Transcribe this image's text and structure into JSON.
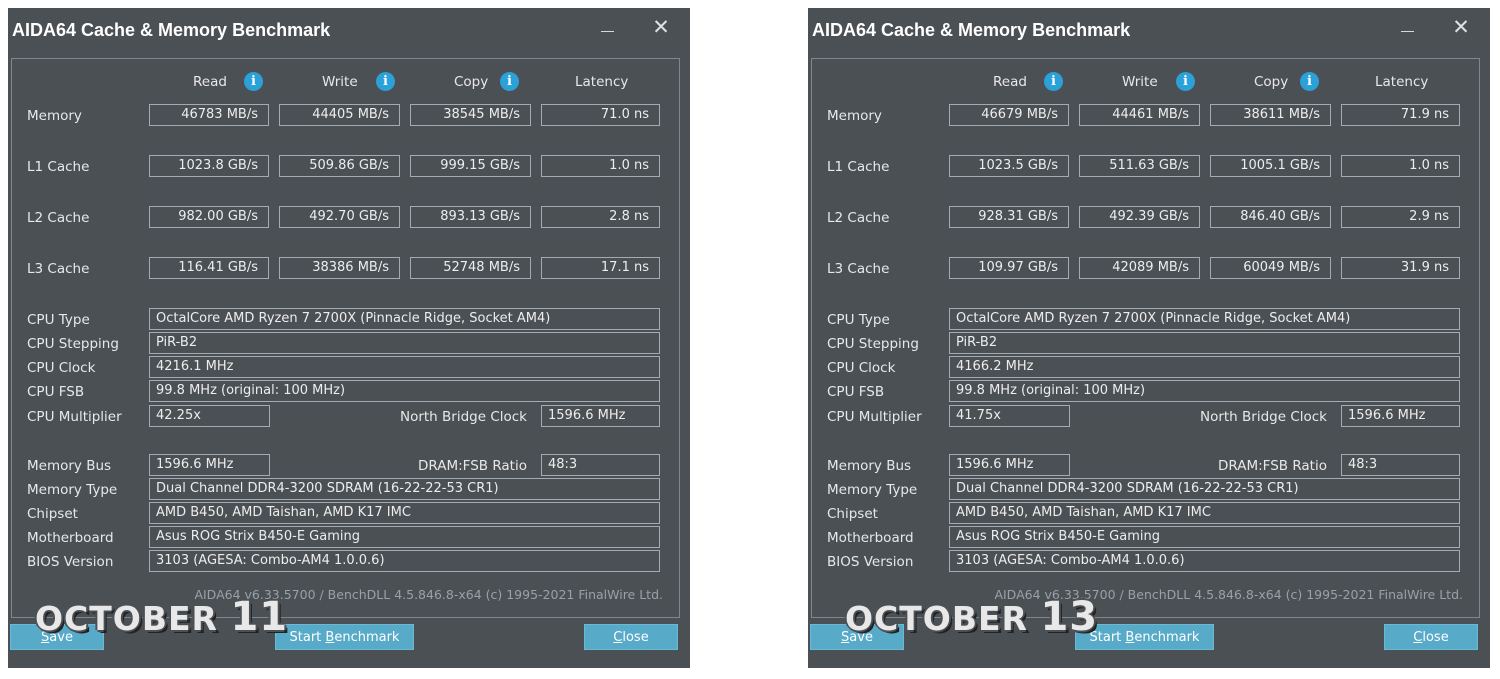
{
  "window_title": "AIDA64 Cache & Memory Benchmark",
  "icons": {
    "minimize": "minimize-icon",
    "close": "close-icon",
    "info": "info-icon"
  },
  "columns": {
    "read": "Read",
    "write": "Write",
    "copy": "Copy",
    "latency": "Latency",
    "info_glyph": "i"
  },
  "colors": {
    "window_bg": "#4b5055",
    "button_bg": "#58aac9",
    "info_icon": "#2aa1d9"
  },
  "labels": {
    "memory": "Memory",
    "l1": "L1 Cache",
    "l2": "L2 Cache",
    "l3": "L3 Cache",
    "cpu_type": "CPU Type",
    "cpu_stepping": "CPU Stepping",
    "cpu_clock": "CPU Clock",
    "cpu_fsb": "CPU FSB",
    "cpu_multiplier": "CPU Multiplier",
    "nb_clock": "North Bridge Clock",
    "memory_bus": "Memory Bus",
    "dram_fsb": "DRAM:FSB Ratio",
    "memory_type": "Memory Type",
    "chipset": "Chipset",
    "motherboard": "Motherboard",
    "bios": "BIOS Version"
  },
  "buttons": {
    "save_first": "S",
    "save_rest": "ave",
    "start_pre": "Start ",
    "start_ul": "B",
    "start_post": "enchmark",
    "close_first": "C",
    "close_rest": "lose"
  },
  "footer": "AIDA64 v6.33.5700 / BenchDLL 4.5.846.8-x64  (c) 1995-2021 FinalWire Ltd.",
  "left": {
    "overlay_text": "OCTOBER ",
    "overlay_num": "11",
    "memory": {
      "read": "46783 MB/s",
      "write": "44405 MB/s",
      "copy": "38545 MB/s",
      "latency": "71.0 ns"
    },
    "l1": {
      "read": "1023.8 GB/s",
      "write": "509.86 GB/s",
      "copy": "999.15 GB/s",
      "latency": "1.0 ns"
    },
    "l2": {
      "read": "982.00 GB/s",
      "write": "492.70 GB/s",
      "copy": "893.13 GB/s",
      "latency": "2.8 ns"
    },
    "l3": {
      "read": "116.41 GB/s",
      "write": "38386 MB/s",
      "copy": "52748 MB/s",
      "latency": "17.1 ns"
    },
    "cpu_type": "OctalCore AMD Ryzen 7 2700X  (Pinnacle Ridge, Socket AM4)",
    "cpu_stepping": "PiR-B2",
    "cpu_clock": "4216.1 MHz",
    "cpu_fsb": "99.8 MHz  (original: 100 MHz)",
    "cpu_multiplier": "42.25x",
    "nb_clock": "1596.6 MHz",
    "memory_bus": "1596.6 MHz",
    "dram_fsb": "48:3",
    "memory_type": "Dual Channel DDR4-3200 SDRAM  (16-22-22-53 CR1)",
    "chipset": "AMD B450, AMD Taishan, AMD K17 IMC",
    "motherboard": "Asus ROG Strix B450-E Gaming",
    "bios": "3103  (AGESA: Combo-AM4 1.0.0.6)"
  },
  "right": {
    "overlay_text": "OCTOBER ",
    "overlay_num": "13",
    "memory": {
      "read": "46679 MB/s",
      "write": "44461 MB/s",
      "copy": "38611 MB/s",
      "latency": "71.9 ns"
    },
    "l1": {
      "read": "1023.5 GB/s",
      "write": "511.63 GB/s",
      "copy": "1005.1 GB/s",
      "latency": "1.0 ns"
    },
    "l2": {
      "read": "928.31 GB/s",
      "write": "492.39 GB/s",
      "copy": "846.40 GB/s",
      "latency": "2.9 ns"
    },
    "l3": {
      "read": "109.97 GB/s",
      "write": "42089 MB/s",
      "copy": "60049 MB/s",
      "latency": "31.9 ns"
    },
    "cpu_type": "OctalCore AMD Ryzen 7 2700X  (Pinnacle Ridge, Socket AM4)",
    "cpu_stepping": "PiR-B2",
    "cpu_clock": "4166.2 MHz",
    "cpu_fsb": "99.8 MHz  (original: 100 MHz)",
    "cpu_multiplier": "41.75x",
    "nb_clock": "1596.6 MHz",
    "memory_bus": "1596.6 MHz",
    "dram_fsb": "48:3",
    "memory_type": "Dual Channel DDR4-3200 SDRAM  (16-22-22-53 CR1)",
    "chipset": "AMD B450, AMD Taishan, AMD K17 IMC",
    "motherboard": "Asus ROG Strix B450-E Gaming",
    "bios": "3103  (AGESA: Combo-AM4 1.0.0.6)"
  }
}
